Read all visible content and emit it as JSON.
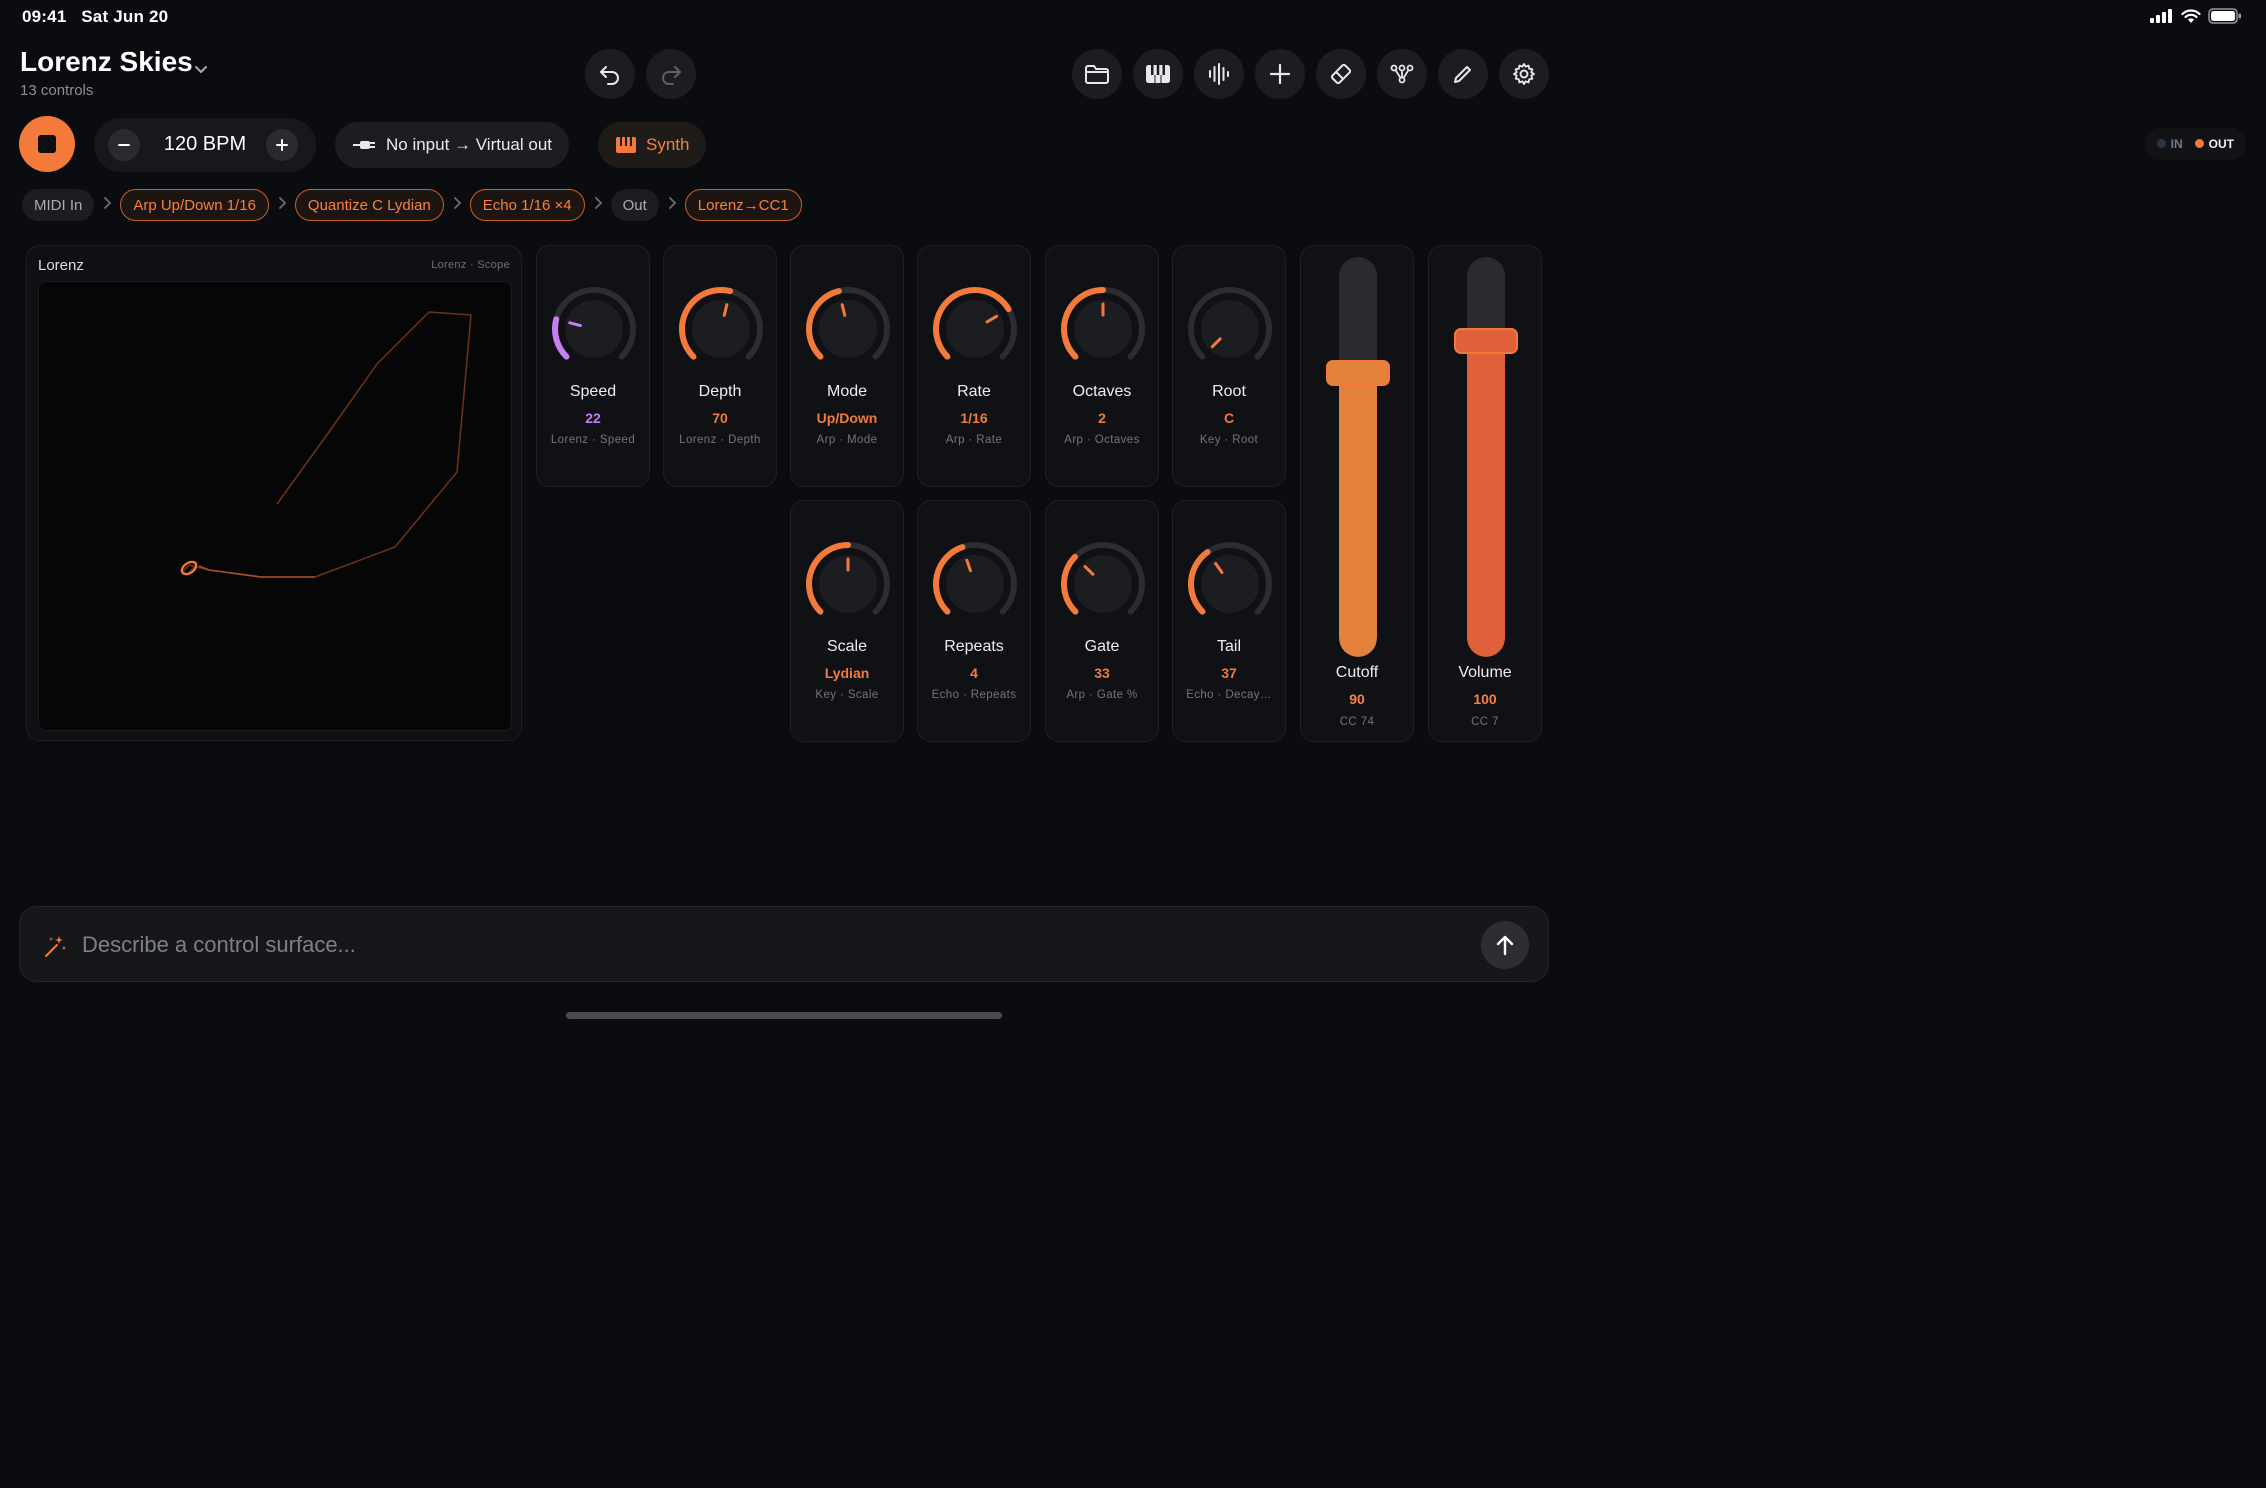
{
  "status": {
    "time": "09:41",
    "date": "Sat Jun 20"
  },
  "header": {
    "title": "Lorenz Skies",
    "subtitle": "13 controls"
  },
  "toolbar": {
    "icons": [
      "undo-icon",
      "redo-icon",
      "folder-icon",
      "piano-icon",
      "waveform-icon",
      "plus-icon",
      "eraser-icon",
      "graph-icon",
      "pencil-icon",
      "gear-icon"
    ]
  },
  "transport": {
    "bpm_label": "120 BPM",
    "routing": "No input → Virtual out",
    "instrument": "Synth",
    "in_label": "IN",
    "out_label": "OUT"
  },
  "chain": [
    {
      "label": "MIDI In",
      "active": false
    },
    {
      "label": "Arp Up/Down 1/16",
      "active": true
    },
    {
      "label": "Quantize C Lydian",
      "active": true
    },
    {
      "label": "Echo 1/16 ×4",
      "active": true
    },
    {
      "label": "Out",
      "active": false
    },
    {
      "label": "Lorenz→CC1",
      "active": true
    }
  ],
  "scope": {
    "title": "Lorenz",
    "subtitle": "Lorenz · Scope"
  },
  "knobs": [
    {
      "name": "Speed",
      "value": "22",
      "sub": "Lorenz · Speed",
      "level": 0.22,
      "color": "#c67ef2"
    },
    {
      "name": "Depth",
      "value": "70",
      "sub": "Lorenz · Depth",
      "level": 0.55,
      "color": "#f37a3a"
    },
    {
      "name": "Mode",
      "value": "Up/Down",
      "sub": "Arp · Mode",
      "level": 0.45,
      "color": "#f37a3a"
    },
    {
      "name": "Rate",
      "value": "1/16",
      "sub": "Arp · Rate",
      "level": 0.72,
      "color": "#f37a3a"
    },
    {
      "name": "Octaves",
      "value": "2",
      "sub": "Arp · Octaves",
      "level": 0.5,
      "color": "#f37a3a"
    },
    {
      "name": "Root",
      "value": "C",
      "sub": "Key · Root",
      "level": 0.0,
      "color": "#f37a3a"
    },
    {
      "name": "Scale",
      "value": "Lydian",
      "sub": "Key · Scale",
      "level": 0.5,
      "color": "#f37a3a"
    },
    {
      "name": "Repeats",
      "value": "4",
      "sub": "Echo · Repeats",
      "level": 0.43,
      "color": "#f37a3a"
    },
    {
      "name": "Gate",
      "value": "33",
      "sub": "Arp · Gate %",
      "level": 0.33,
      "color": "#f37a3a"
    },
    {
      "name": "Tail",
      "value": "37",
      "sub": "Echo · Decay…",
      "level": 0.37,
      "color": "#f37a3a"
    }
  ],
  "sliders": [
    {
      "name": "Cutoff",
      "value": "90",
      "sub": "CC 74",
      "level": 0.71,
      "color": "#e4823d"
    },
    {
      "name": "Volume",
      "value": "100",
      "sub": "CC 7",
      "level": 0.79,
      "color": "#e0603a"
    }
  ],
  "prompt": {
    "placeholder": "Describe a control surface..."
  }
}
